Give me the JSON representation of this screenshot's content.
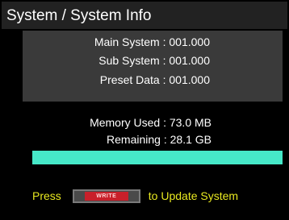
{
  "screen": {
    "title": "System / System Info"
  },
  "versions": {
    "main_system": "Main System : 001.000",
    "sub_system": "Sub System : 001.000",
    "preset_data": "Preset Data : 001.000"
  },
  "memory": {
    "used_label": "Memory Used : 73.0 MB",
    "remaining_label": "Remaining : 28.1 GB",
    "usage_fraction": 1.0,
    "bar_color": "#46e8c8"
  },
  "update_prompt": {
    "press_label": "Press",
    "key_label": "WRITE",
    "action_label": "to Update System",
    "text_color": "#e8e820",
    "key_color": "#c8202a"
  }
}
